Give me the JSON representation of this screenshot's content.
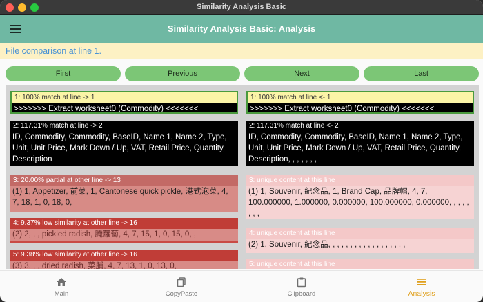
{
  "window": {
    "title": "Similarity Analysis Basic"
  },
  "appbar": {
    "title": "Similarity Analysis Basic: Analysis"
  },
  "status": {
    "text": "File comparison at line 1."
  },
  "nav": {
    "first": "First",
    "previous": "Previous",
    "next": "Next",
    "last": "Last"
  },
  "left": [
    {
      "header": "1: 100% match at line -> 1",
      "body": ">>>>>>> Extract worksheet0 (Commodity) <<<<<<<"
    },
    {
      "header": "2: 117.31% match at line -> 2",
      "body": "ID, Commodity, Commodity, BaseID, Name 1, Name 2, Type, Unit, Unit Price, Mark Down / Up, VAT, Retail Price, Quantity, Description"
    },
    {
      "header": "3: 20.00% partial at other line -> 13",
      "body": "(1) 1, Appetizer, 前菜, 1, Cantonese quick pickle, 港式泡菜, 4, 7, 18, 1, 0, 18, 0,"
    },
    {
      "header": "4: 9.37% low similarity at other line -> 16",
      "body": "(2) 2, , , pickled radish, 腌蘿蔔, 4, 7, 15, 1, 0, 15, 0, ,"
    },
    {
      "header": "5: 9.38% low similarity at other line -> 16",
      "body": "(3) 3, , , dried radish, 菜脯, 4, 7, 13, 1, 0, 13, 0,"
    }
  ],
  "right": [
    {
      "header": "1: 100% match at line <- 1",
      "body": ">>>>>>> Extract worksheet0 (Commodity) <<<<<<<"
    },
    {
      "header": "2: 117.31% match at line <- 2",
      "body": "ID, Commodity, Commodity, BaseID, Name 1, Name 2, Type, Unit, Unit Price, Mark Down / Up, VAT, Retail Price, Quantity, Description, , , , , , ,"
    },
    {
      "header": "3: unique content at this line",
      "body": "(1) 1, Souvenir, 紀念品, 1, Brand Cap, 品牌帽, 4, 7, 100.000000, 1.000000, 0.000000, 100.000000, 0.000000, , , , , , , ,"
    },
    {
      "header": "4: unique content at this line",
      "body": "(2) 1, Souvenir, 紀念品, , , , , , , , , , , , , , , , , ,"
    },
    {
      "header": "5: unique content at this line",
      "body": ""
    }
  ],
  "bottom_nav": {
    "main": "Main",
    "copypaste": "CopyPaste",
    "clipboard": "Clipboard",
    "analysis": "Analysis"
  },
  "colors": {
    "appbar": "#6fb8a3",
    "button": "#7cc676",
    "status_bg": "#fdf1c4",
    "status_text": "#4a93d4",
    "active_tab": "#e0a11f"
  }
}
